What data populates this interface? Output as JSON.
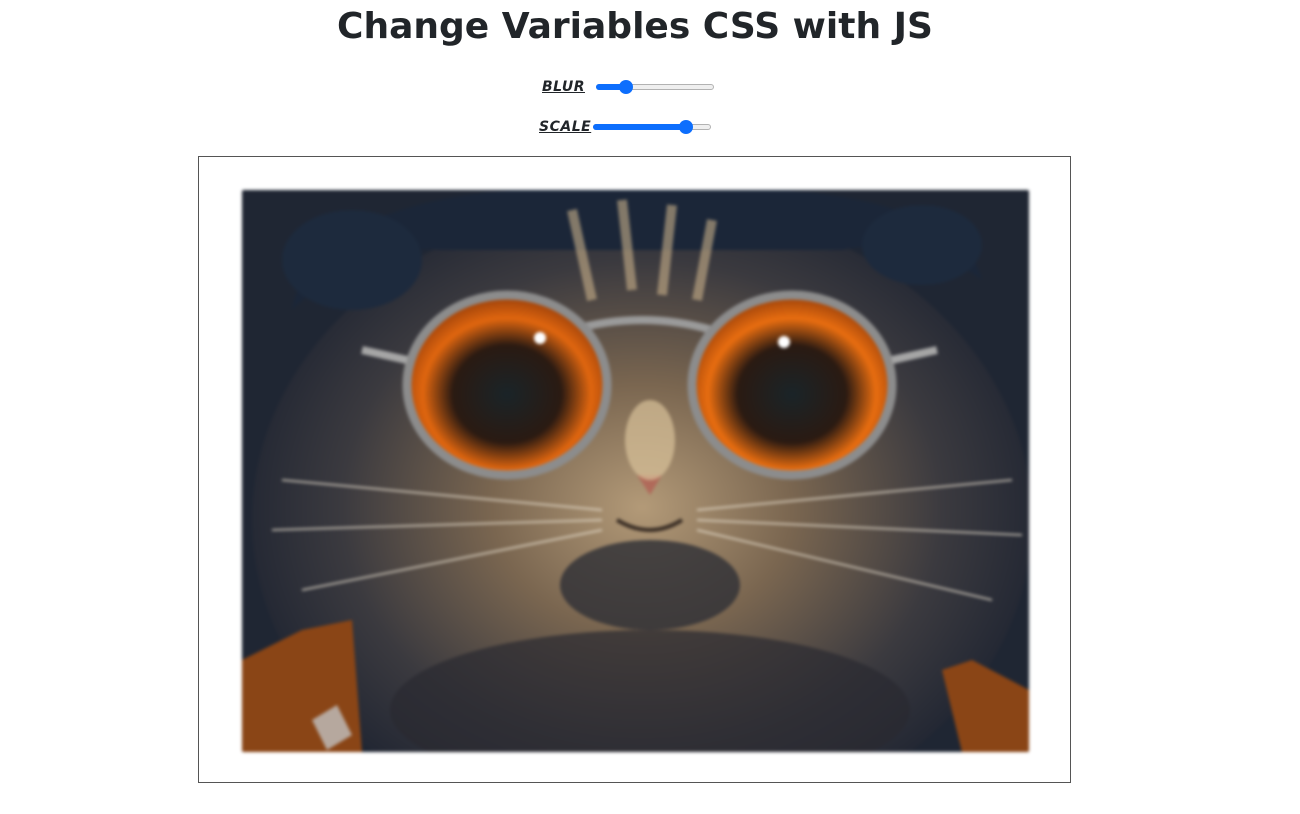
{
  "header": {
    "title": "Change Variables CSS with JS"
  },
  "controls": {
    "blur": {
      "label": "BLUR",
      "value_fraction": 0.22,
      "accent": "#0d6efd"
    },
    "scale": {
      "label": "SCALE",
      "value_fraction": 0.83,
      "accent": "#0d6efd"
    }
  },
  "image": {
    "subject": "cat wearing orange-tinted round sunglasses and a dark cap"
  }
}
